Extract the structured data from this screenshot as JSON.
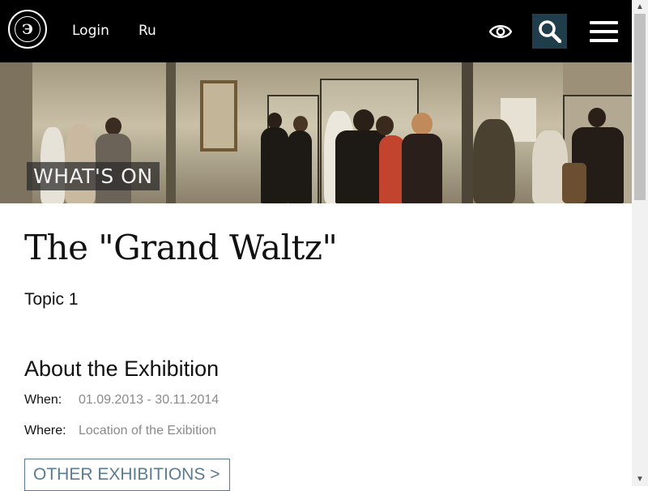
{
  "header": {
    "logo_glyph": "Э",
    "login_label": "Login",
    "language_label": "Ru",
    "accessibility_icon": "eye-icon",
    "search_icon": "search-icon",
    "menu_icon": "hamburger-menu-icon",
    "search_bg_color": "#1f3d4a"
  },
  "hero": {
    "label": "WHAT'S ON"
  },
  "exhibition": {
    "title": "The \"Grand Waltz\"",
    "topic": "Topic 1",
    "section_title": "About the Exhibition",
    "when_label": "When:",
    "when_value": "01.09.2013 - 30.11.2014",
    "where_label": "Where:",
    "where_value": "Location of the Exibition",
    "other_button": "OTHER EXHIBITIONS >",
    "accent_color": "#5b7c8d"
  },
  "scrollbar": {
    "up_icon": "scroll-up-arrow-icon",
    "down_icon": "scroll-down-arrow-icon"
  }
}
